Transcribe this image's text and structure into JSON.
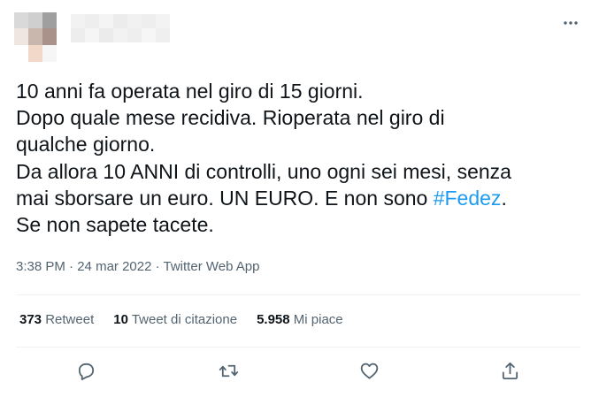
{
  "tweet": {
    "lines": [
      "10 anni fa operata nel giro di 15 giorni.",
      "Dopo quale mese recidiva. Rioperata nel giro di",
      "qualche giorno.",
      "Da allora 10 ANNI di controlli, uno ogni sei mesi, senza",
      "mai sborsare un euro. UN EURO. E non sono ",
      "Se non sapete tacete."
    ],
    "hashtag": "#Fedez",
    "hashtag_trailing": "."
  },
  "meta": {
    "time": "3:38 PM",
    "separator": " · ",
    "date": "24 mar 2022",
    "source": "Twitter Web App"
  },
  "stats": {
    "retweets_count": "373",
    "retweets_label": "Retweet",
    "quotes_count": "10",
    "quotes_label": "Tweet di citazione",
    "likes_count": "5.958",
    "likes_label": "Mi piace"
  },
  "icons": {
    "more": "more-dots-icon",
    "reply": "reply-icon",
    "retweet": "retweet-icon",
    "like": "heart-icon",
    "share": "share-icon"
  },
  "colors": {
    "text": "#0f1419",
    "secondary": "#536471",
    "link": "#1d9bf0",
    "divider": "#eff3f4"
  }
}
